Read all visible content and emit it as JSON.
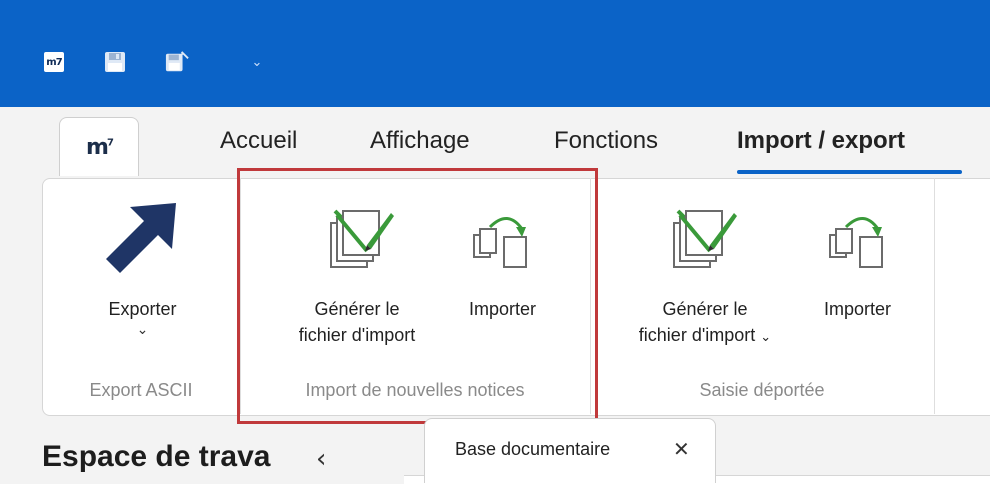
{
  "quick_access": {
    "app_icon": "m7-icon",
    "app_icon_text": "m7",
    "save_icon": "floppy-disk-icon",
    "save_as_icon": "floppy-disk-edit-icon",
    "customize_arrow": "⌄"
  },
  "app_logo": {
    "text": "m",
    "sup": "7"
  },
  "tabs": [
    {
      "label": "Accueil",
      "active": false
    },
    {
      "label": "Affichage",
      "active": false
    },
    {
      "label": "Fonctions",
      "active": false
    },
    {
      "label": "Import / export",
      "active": true
    }
  ],
  "ribbon": {
    "groups": [
      {
        "label": "Export ASCII",
        "buttons": [
          {
            "label": "Exporter",
            "has_dropdown": true,
            "icon": "arrow-up-right-icon"
          }
        ]
      },
      {
        "label": "Import de nouvelles notices",
        "highlighted": true,
        "buttons": [
          {
            "label_line1": "Générer le",
            "label_line2": "fichier d'import",
            "has_dropdown": false,
            "icon": "generate-import-file-icon"
          },
          {
            "label": "Importer",
            "icon": "import-documents-icon"
          }
        ]
      },
      {
        "label": "Saisie déportée",
        "buttons": [
          {
            "label_line1": "Générer le",
            "label_line2": "fichier d'import",
            "has_dropdown": true,
            "icon": "generate-import-file-icon"
          },
          {
            "label": "Importer",
            "icon": "import-documents-icon"
          }
        ]
      }
    ]
  },
  "workspace": {
    "title": "Espace de trava"
  },
  "document_tab": {
    "label": "Base documentaire",
    "close": "✕"
  },
  "colors": {
    "titlebar": "#0b63c7",
    "highlight": "#c0393b",
    "accent_green": "#3a9a3a",
    "icon_navy": "#1f3566"
  }
}
